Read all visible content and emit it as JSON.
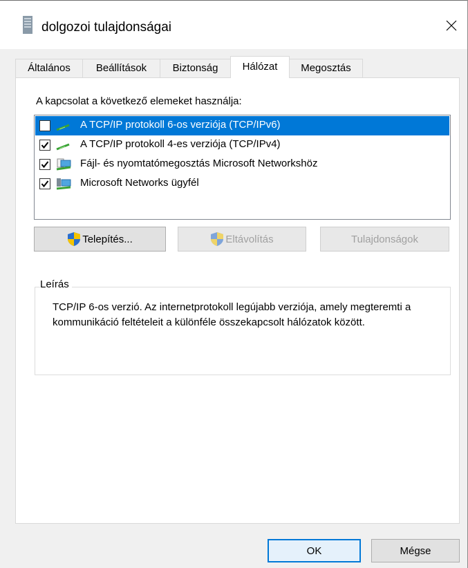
{
  "window": {
    "title": "dolgozoi tulajdonságai",
    "close_symbol": "✕"
  },
  "tabs": [
    {
      "label": "Általános"
    },
    {
      "label": "Beállítások"
    },
    {
      "label": "Biztonság"
    },
    {
      "label": "Hálózat",
      "active": true
    },
    {
      "label": "Megosztás"
    }
  ],
  "network": {
    "usage_label": "A kapcsolat a következő elemeket használja:",
    "items": [
      {
        "label": "A TCP/IP protokoll 6-os verziója (TCP/IPv6)",
        "checked": false,
        "selected": true,
        "icon": "network-protocol-icon"
      },
      {
        "label": "A TCP/IP protokoll 4-es verziója (TCP/IPv4)",
        "checked": true,
        "selected": false,
        "icon": "network-protocol-icon"
      },
      {
        "label": "Fájl- és nyomtatómegosztás Microsoft Networkshöz",
        "checked": true,
        "selected": false,
        "icon": "file-print-sharing-icon"
      },
      {
        "label": "Microsoft Networks ügyfél",
        "checked": true,
        "selected": false,
        "icon": "network-client-icon"
      }
    ],
    "buttons": {
      "install": "Telepítés...",
      "uninstall": "Eltávolítás",
      "properties": "Tulajdonságok"
    },
    "description": {
      "title": "Leírás",
      "text": "TCP/IP 6-os verzió. Az internetprotokoll legújabb verziója, amely megteremti a kommunikáció feltételeit a különféle összekapcsolt hálózatok között."
    }
  },
  "footer": {
    "ok": "OK",
    "cancel": "Mégse"
  },
  "colors": {
    "selection": "#0078d7",
    "shield_blue": "#2a6fcf",
    "shield_yellow": "#f5c400"
  }
}
